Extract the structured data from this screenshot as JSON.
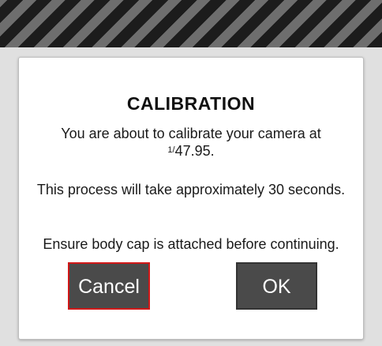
{
  "dialog": {
    "title": "CALIBRATION",
    "message_line1": "You are about to calibrate your camera at",
    "shutter_numerator": "1/",
    "shutter_denominator": "47.95.",
    "message_line2": "This process will take approximately 30 seconds.",
    "message_line3": "Ensure body cap is attached before continuing.",
    "cancel_label": "Cancel",
    "ok_label": "OK"
  },
  "colors": {
    "cancel_focus_border": "#d01818",
    "button_bg": "#4a4a4a",
    "header_stripe_dark": "#1c1c1c",
    "header_stripe_light": "#6e6e6e"
  }
}
